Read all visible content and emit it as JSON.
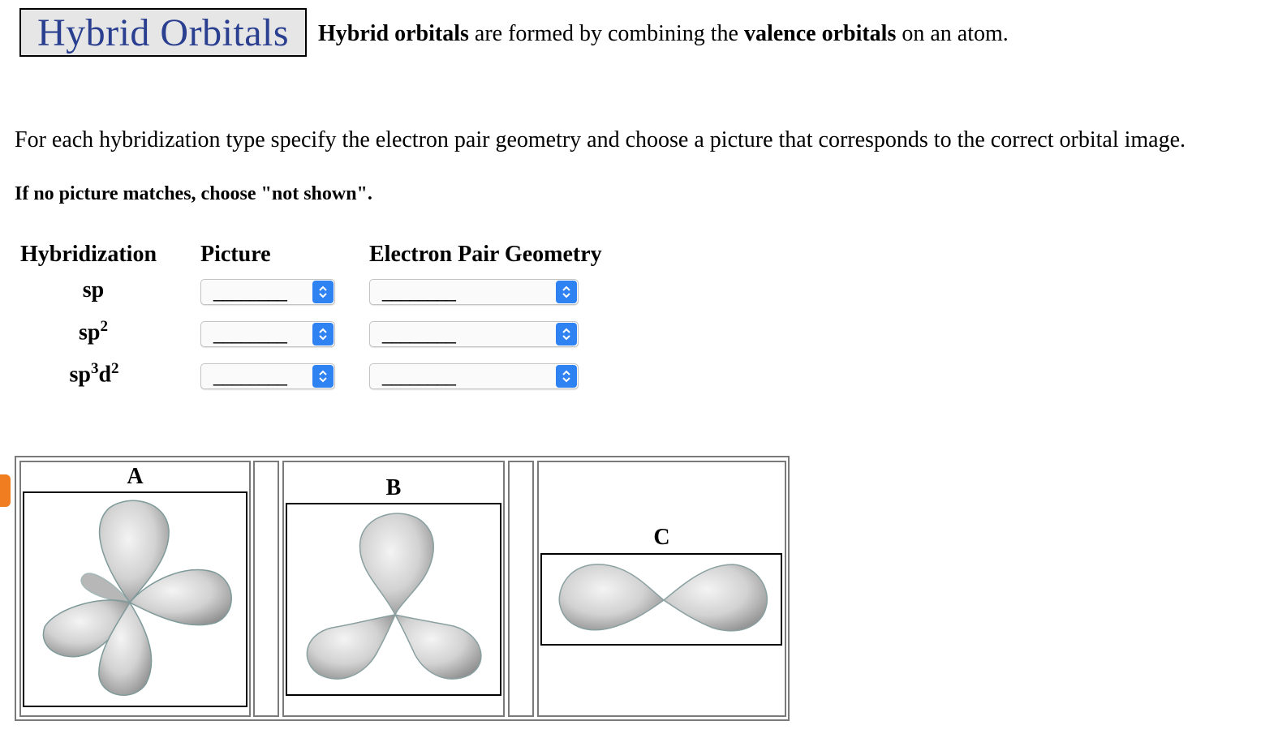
{
  "header": {
    "title": "Hybrid Orbitals",
    "intro": [
      {
        "text": "Hybrid orbitals",
        "bold": true
      },
      {
        "text": " are formed by combining the ",
        "bold": false
      },
      {
        "text": "valence orbitals",
        "bold": true
      },
      {
        "text": " on an atom.",
        "bold": false
      }
    ]
  },
  "instructions": {
    "text": "For each hybridization type specify the electron pair geometry and choose a picture that corresponds to the correct orbital image.",
    "note": "If no picture matches, choose \"not shown\"."
  },
  "table": {
    "headers": {
      "hybridization": "Hybridization",
      "picture": "Picture",
      "geometry": "Electron Pair Geometry"
    },
    "rows": [
      {
        "base": "sp",
        "sup1": "",
        "mid": "",
        "sup2": "",
        "picture": "________",
        "geometry": "________"
      },
      {
        "base": "sp",
        "sup1": "2",
        "mid": "",
        "sup2": "",
        "picture": "________",
        "geometry": "________"
      },
      {
        "base": "sp",
        "sup1": "3",
        "mid": "d",
        "sup2": "2",
        "picture": "________",
        "geometry": "________"
      }
    ]
  },
  "pictures": [
    {
      "letter": "A",
      "icon": "four-lobe-orbital-image"
    },
    {
      "letter": "B",
      "icon": "three-lobe-orbital-image"
    },
    {
      "letter": "C",
      "icon": "two-lobe-orbital-image"
    }
  ],
  "colors": {
    "title_text": "#2a3f8f",
    "title_bg": "#e6e6e6",
    "select_arrow": "#2f82f2",
    "side_tab": "#f07d20"
  }
}
